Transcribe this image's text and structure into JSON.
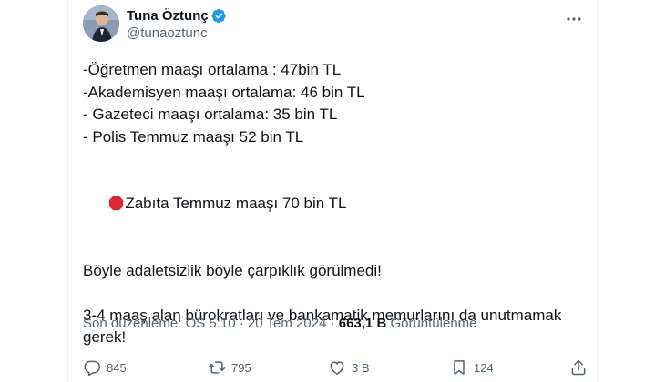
{
  "author": {
    "display_name": "Tuna Öztunç",
    "handle": "@tunaoztunc",
    "avatar_icon": "avatar-photo",
    "verified_icon": "verified-badge-icon",
    "verified_color": "#1d9bf0"
  },
  "tweet": {
    "lines": [
      "-Öğretmen maaşı ortalama : 47bin TL",
      "-Akademisyen maaşı ortalama: 46 bin TL",
      "- Gazeteci maaşı ortalama: 35 bin TL",
      "- Polis Temmuz maaşı 52 bin TL"
    ],
    "highlight_icon": "stop-sign-icon",
    "highlight_line": "Zabıta Temmuz maaşı 70 bin TL",
    "paragraph_1": "Böyle adaletsizlik böyle çarpıklık görülmedi!",
    "paragraph_2_line_1": "3-4 maaş alan bürokratları ve bankamatik memurlarını da unutmamak",
    "paragraph_2_line_2": "gerek!"
  },
  "meta": {
    "edited_label": "Son düzenleme: ÖS 5:10 · 20 Tem 2024 · ",
    "views_count": "663,1 B",
    "views_label": " Görüntülenme"
  },
  "actions": {
    "reply_count": "845",
    "retweet_count": "795",
    "like_count": "3 B",
    "bookmark_count": "124",
    "reply_icon": "reply-icon",
    "retweet_icon": "retweet-icon",
    "like_icon": "heart-icon",
    "bookmark_icon": "bookmark-icon",
    "share_icon": "share-icon"
  },
  "colors": {
    "text_primary": "#0f1419",
    "text_secondary": "#536471",
    "stop_red": "#e0243a"
  }
}
